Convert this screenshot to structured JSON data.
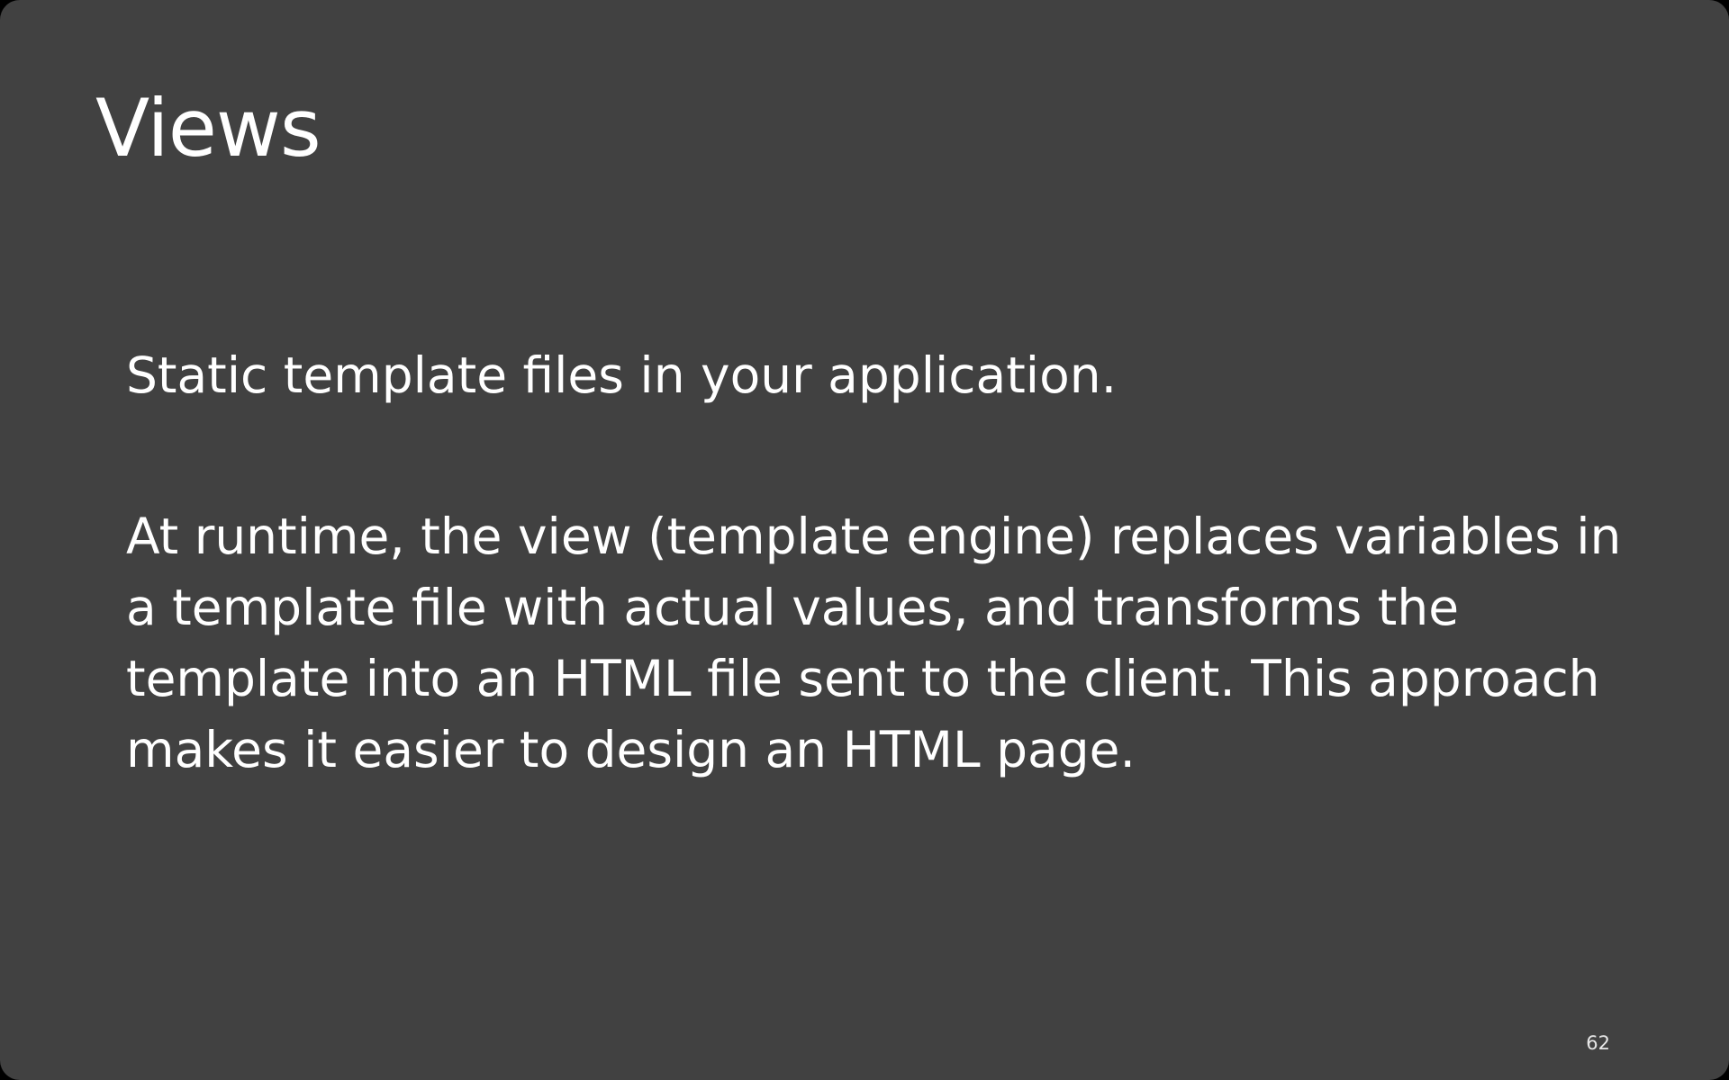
{
  "slide": {
    "title": "Views",
    "paragraphs": [
      "Static template files in your application.",
      "At runtime, the view (template engine) replaces variables in a template file with actual values, and transforms the template into an HTML file sent to the client. This approach makes it easier to design an HTML page."
    ],
    "page_number": "62"
  },
  "colors": {
    "background": "#414141",
    "text": "#ffffff"
  }
}
